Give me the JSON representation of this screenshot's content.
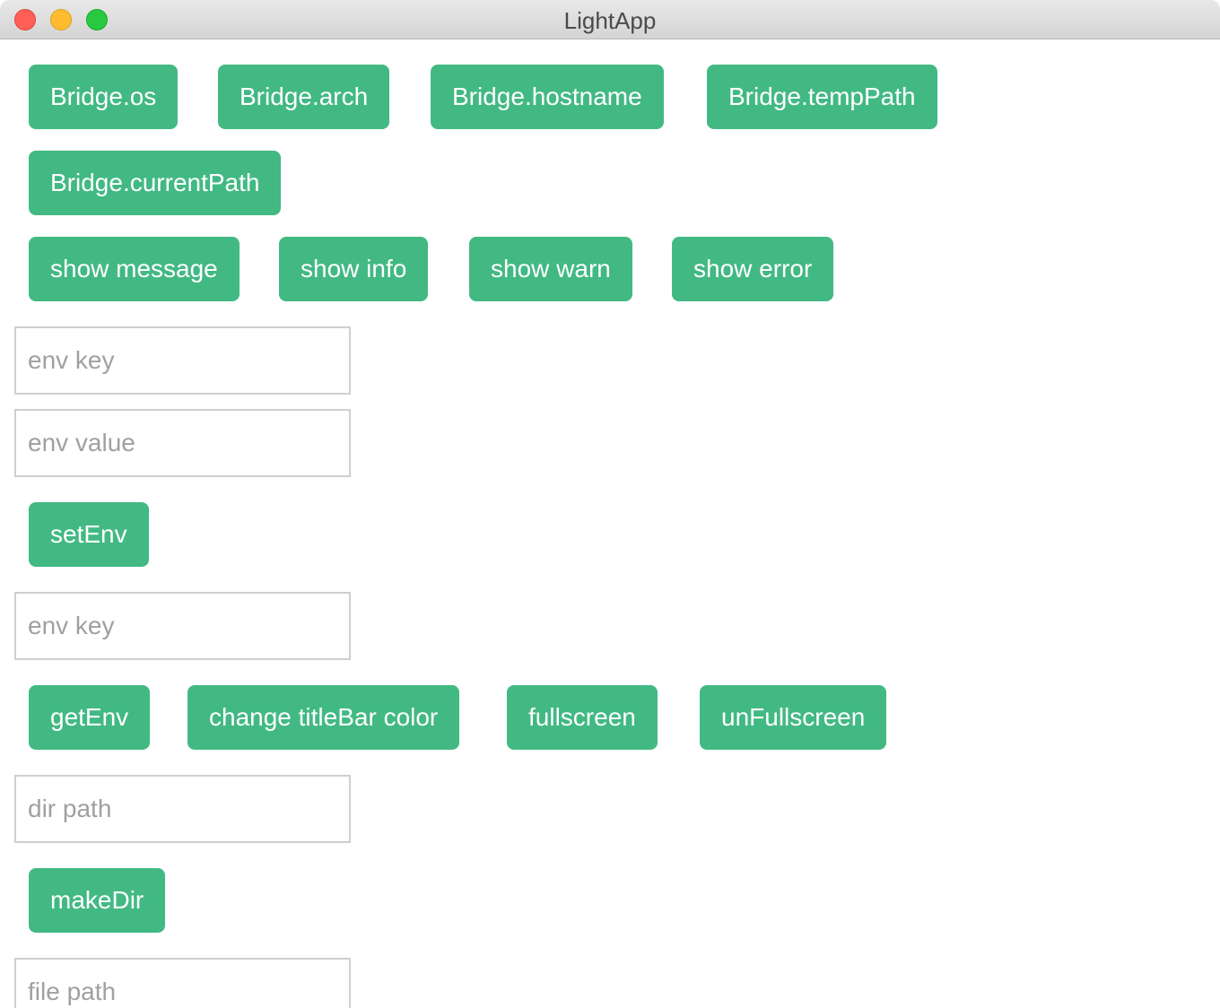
{
  "window": {
    "title": "LightApp"
  },
  "colors": {
    "button_bg": "#42b983",
    "button_text": "#ffffff",
    "input_border": "#cfcfcf",
    "placeholder": "#a0a0a0"
  },
  "bridge_buttons": {
    "os": "Bridge.os",
    "arch": "Bridge.arch",
    "hostname": "Bridge.hostname",
    "temp_path": "Bridge.tempPath",
    "current_path": "Bridge.currentPath"
  },
  "dialog_buttons": {
    "message": "show message",
    "info": "show info",
    "warn": "show warn",
    "error": "show error"
  },
  "env_set": {
    "key_placeholder": "env key",
    "value_placeholder": "env value",
    "button": "setEnv"
  },
  "env_get": {
    "key_placeholder": "env key",
    "button": "getEnv"
  },
  "window_buttons": {
    "titlebar_color": "change titleBar color",
    "fullscreen": "fullscreen",
    "unfullscreen": "unFullscreen"
  },
  "make_dir": {
    "path_placeholder": "dir path",
    "button": "makeDir"
  },
  "file": {
    "path_placeholder": "file path"
  }
}
